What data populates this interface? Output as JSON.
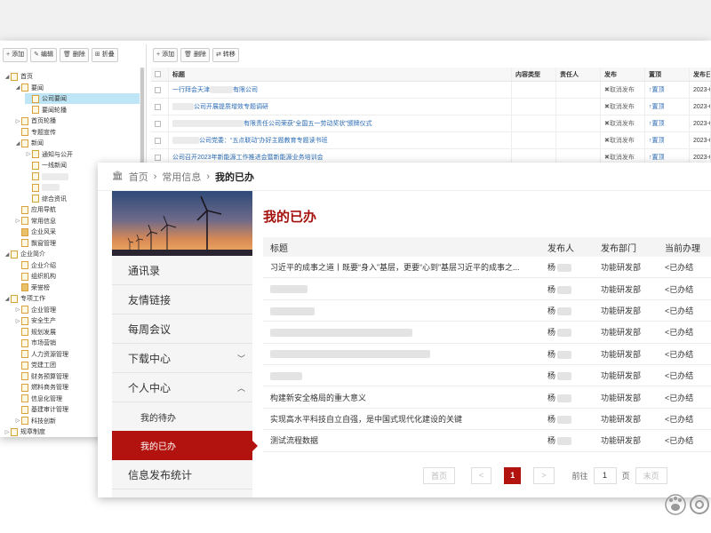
{
  "left_toolbar": [
    {
      "icon": "+",
      "label": "添加"
    },
    {
      "icon": "✎",
      "label": "编辑"
    },
    {
      "icon": "🗑",
      "label": "删除"
    },
    {
      "icon": "⊞",
      "label": "折叠"
    }
  ],
  "right_toolbar": [
    {
      "icon": "+",
      "label": "添加"
    },
    {
      "icon": "🗑",
      "label": "删除"
    },
    {
      "icon": "⇄",
      "label": "转移"
    }
  ],
  "tree": [
    {
      "label": "首页",
      "level": 0,
      "arrow": "open"
    },
    {
      "label": "要闻",
      "level": 1,
      "arrow": "open"
    },
    {
      "label": "公司要闻",
      "level": 2,
      "arrow": "",
      "selected": true
    },
    {
      "label": "要闻轮播",
      "level": 2,
      "arrow": ""
    },
    {
      "label": "首页轮播",
      "level": 1,
      "arrow": "closed"
    },
    {
      "label": "专题宣传",
      "level": 1,
      "arrow": ""
    },
    {
      "label": "新闻",
      "level": 1,
      "arrow": "open"
    },
    {
      "label": "通知与公开",
      "level": 2,
      "arrow": "closed"
    },
    {
      "label": "一线新闻",
      "level": 2,
      "arrow": ""
    },
    {
      "label": "",
      "level": 2,
      "arrow": "",
      "blur": 30
    },
    {
      "label": "",
      "level": 2,
      "arrow": "",
      "blur": 20
    },
    {
      "label": "综合资讯",
      "level": 2,
      "arrow": ""
    },
    {
      "label": "应用导航",
      "level": 1,
      "arrow": ""
    },
    {
      "label": "常用信息",
      "level": 1,
      "arrow": "closed"
    },
    {
      "label": "企业风采",
      "level": 1,
      "arrow": "",
      "img": true
    },
    {
      "label": "飘窗管理",
      "level": 1,
      "arrow": ""
    },
    {
      "label": "企业简介",
      "level": 0,
      "arrow": "open"
    },
    {
      "label": "企业介绍",
      "level": 1,
      "arrow": ""
    },
    {
      "label": "组织机构",
      "level": 1,
      "arrow": ""
    },
    {
      "label": "荣誉榜",
      "level": 1,
      "arrow": "",
      "img": true
    },
    {
      "label": "专项工作",
      "level": 0,
      "arrow": "open"
    },
    {
      "label": "企业管理",
      "level": 1,
      "arrow": "closed"
    },
    {
      "label": "安全生产",
      "level": 1,
      "arrow": "closed"
    },
    {
      "label": "规划发展",
      "level": 1,
      "arrow": ""
    },
    {
      "label": "市场营销",
      "level": 1,
      "arrow": ""
    },
    {
      "label": "人力资源管理",
      "level": 1,
      "arrow": ""
    },
    {
      "label": "党建工团",
      "level": 1,
      "arrow": ""
    },
    {
      "label": "财务预算管理",
      "level": 1,
      "arrow": ""
    },
    {
      "label": "燃料商务管理",
      "level": 1,
      "arrow": ""
    },
    {
      "label": "信息化管理",
      "level": 1,
      "arrow": ""
    },
    {
      "label": "基建审计管理",
      "level": 1,
      "arrow": ""
    },
    {
      "label": "科技创新",
      "level": 1,
      "arrow": "closed"
    },
    {
      "label": "规章制度",
      "level": 0,
      "arrow": "closed"
    }
  ],
  "grid": {
    "headers": [
      "标题",
      "内容类型",
      "责任人",
      "发布",
      "置顶",
      "发布日期"
    ],
    "rows": [
      {
        "title": "一行拜会天津",
        "title2": "有限公司",
        "blur": 26,
        "publish": "✖取消发布",
        "top": "↑置顶",
        "date": "2023-0"
      },
      {
        "title": "",
        "title2": "公司开展提质增效专题调研",
        "blur": 24,
        "publish": "✖取消发布",
        "top": "↑置顶",
        "date": "2023-0"
      },
      {
        "title": "",
        "title2": "有限责任公司荣获“全国五一劳动奖状”颁牌仪式",
        "blur": 80,
        "publish": "✖取消发布",
        "top": "↑置顶",
        "date": "2023-0"
      },
      {
        "title": "",
        "title2": "公司党委：“五点联动”办好主题教育专题读书班",
        "blur": 30,
        "publish": "✖取消发布",
        "top": "↑置顶",
        "date": "2023-0"
      },
      {
        "title": "公司召开2023年新能源工作推进会暨新能源业务培训会",
        "title2": "",
        "blur": 0,
        "publish": "✖取消发布",
        "top": "↑置顶",
        "date": "2023-0"
      }
    ]
  },
  "front": {
    "breadcrumb": [
      "首页",
      "常用信息",
      "我的已办"
    ],
    "menu": [
      {
        "label": "通讯录",
        "chev": ""
      },
      {
        "label": "友情链接",
        "chev": ""
      },
      {
        "label": "每周会议",
        "chev": ""
      },
      {
        "label": "下载中心",
        "chev": "﹀"
      },
      {
        "label": "个人中心",
        "chev": "︿"
      },
      {
        "label": "我的待办",
        "chev": "",
        "sub": true
      },
      {
        "label": "我的已办",
        "chev": "",
        "sub": true,
        "active": true
      },
      {
        "label": "信息发布统计",
        "chev": ""
      }
    ],
    "page_title": "我的已办",
    "table_headers": [
      "标题",
      "发布人",
      "发布部门",
      "当前办理"
    ],
    "rows": [
      {
        "title": "习近平的成事之道丨既要“身入”基层，更要“心到”基层习近平的成事之...",
        "blur": 0,
        "publisher": "杨",
        "dept": "功能研发部",
        "status": "<已办结"
      },
      {
        "title": "",
        "blur": 42,
        "publisher": "杨",
        "dept": "功能研发部",
        "status": "<已办结"
      },
      {
        "title": "",
        "blur": 50,
        "publisher": "杨",
        "dept": "功能研发部",
        "status": "<已办结"
      },
      {
        "title": "",
        "blur": 160,
        "publisher": "杨",
        "dept": "功能研发部",
        "status": "<已办结"
      },
      {
        "title": "",
        "blur": 180,
        "publisher": "杨",
        "dept": "功能研发部",
        "status": "<已办结"
      },
      {
        "title": "",
        "blur": 36,
        "publisher": "杨",
        "dept": "功能研发部",
        "status": "<已办结"
      },
      {
        "title": "构建新安全格局的重大意义",
        "blur": 0,
        "publisher": "杨",
        "dept": "功能研发部",
        "status": "<已办结"
      },
      {
        "title": "实现高水平科技自立自强，是中国式现代化建设的关键",
        "blur": 0,
        "publisher": "杨",
        "dept": "功能研发部",
        "status": "<已办结"
      },
      {
        "title": "测试流程数据",
        "blur": 0,
        "publisher": "杨",
        "dept": "功能研发部",
        "status": "<已办结"
      }
    ],
    "pager": {
      "first": "首页",
      "prev": "<",
      "current": "1",
      "next": ">",
      "goto_label": "前往",
      "goto_value": "1",
      "page_unit": "页",
      "last": "末页"
    }
  },
  "colors": {
    "accent": "#b3130f",
    "selected_tree": "#bfe6f6",
    "link": "#2a6ab3"
  }
}
